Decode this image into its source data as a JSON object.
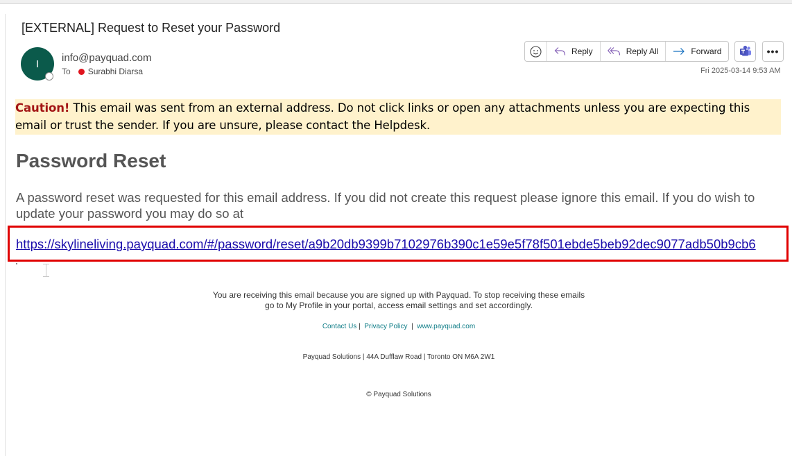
{
  "email": {
    "subject": "[EXTERNAL] Request to Reset your Password",
    "sender": "info@payquad.com",
    "avatar_initial": "I",
    "to_label": "To",
    "recipient": "Surabhi Diarsa",
    "timestamp": "Fri 2025-03-14 9:53 AM"
  },
  "actions": {
    "reply": "Reply",
    "reply_all": "Reply All",
    "forward": "Forward",
    "more": "•••"
  },
  "caution": {
    "label": "Caution!",
    "text": " This email was sent from an external address. Do not click links or open any attachments unless you are expecting this email or trust the sender. If you are unsure, please contact the Helpdesk."
  },
  "body": {
    "heading": "Password Reset",
    "paragraph": "A password reset was requested for this email address. If you did not create this request please ignore this email. If you do wish to update your password you may do so at",
    "link": "https://skylineliving.payquad.com/#/password/reset/a9b20db9399b7102976b390c1e59e5f78f501ebde5beb92dec9077adb50b9cb6"
  },
  "footer": {
    "notice_line1": "You are receiving this email because you are signed up with Payquad. To stop receiving these emails",
    "notice_line2": "go to My Profile in your portal, access email settings and set accordingly.",
    "contact": "Contact Us",
    "privacy": "Privacy Policy",
    "website": "www.payquad.com",
    "separator": "|",
    "address": "Payquad Solutions | 44A Dufflaw Road | Toronto ON M6A 2W1",
    "copyright": "© Payquad Solutions"
  },
  "colors": {
    "avatar": "#0b5a4b",
    "caution_bg": "#fff2cc",
    "caution_label": "#a31515",
    "highlight_box": "#e00000",
    "link": "#1a0dab",
    "footer_link": "#0e7c86",
    "teams": "#5059c9"
  },
  "icons": {
    "emoji": "smiley-icon",
    "reply": "reply-arrow-icon",
    "reply_all": "reply-all-arrow-icon",
    "forward": "forward-arrow-icon",
    "teams": "teams-icon",
    "more": "ellipsis-icon"
  }
}
